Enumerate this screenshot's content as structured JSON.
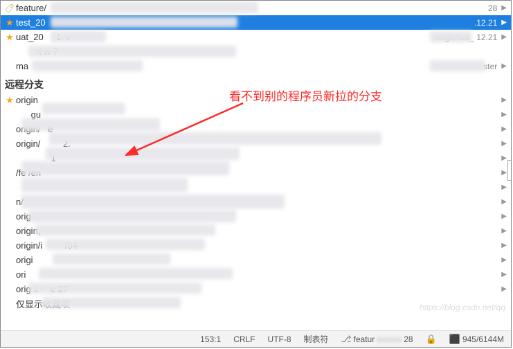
{
  "local_branches": [
    {
      "name": "feature/",
      "tail": "28",
      "right": "28",
      "icon": "tag",
      "star": false,
      "selected": false,
      "arrow": true
    },
    {
      "name": "test_20",
      "tail": "",
      "right": ".12.21",
      "icon": "",
      "star": true,
      "selected": true,
      "arrow": true
    },
    {
      "name": "uat_20",
      "tail": "1",
      "right": "origin/uat_      12.21",
      "icon": "",
      "star": true,
      "selected": false,
      "arrow": true,
      "bluedown": true
    },
    {
      "name": "",
      "tail": "rt  w               7",
      "right": "",
      "icon": "",
      "star": false,
      "selected": false,
      "arrow": false
    },
    {
      "name": "ma",
      "tail": "",
      "right": "ster",
      "icon": "",
      "star": false,
      "selected": false,
      "arrow": true
    }
  ],
  "remote_header": "远程分支",
  "remote_branches": [
    {
      "name": "origin",
      "star": true,
      "arrow": true
    },
    {
      "name": "",
      "tail": "gu",
      "arrow": true
    },
    {
      "name": "origin/",
      "tail": "e",
      "arrow": true
    },
    {
      "name": "origin/",
      "tail": "2.",
      "arrow": true
    },
    {
      "name": "",
      "tail": "1",
      "arrow": true
    },
    {
      "name": "/fe    /en",
      "arrow": true
    },
    {
      "name": "",
      "arrow": true
    },
    {
      "name": "  n/",
      "arrow": true
    },
    {
      "name": "orig",
      "arrow": true
    },
    {
      "name": "origin,",
      "arrow": true
    },
    {
      "name": "origin/i",
      "tail": "/04",
      "arrow": true
    },
    {
      "name": "origi",
      "arrow": true
    },
    {
      "name": "ori",
      "arrow": true
    },
    {
      "name": "orig     s",
      "tail": "e    27",
      "arrow": true
    }
  ],
  "favorites_toggle": "仅显示收藏项",
  "annotation": "看不到别的程序员新拉的分支",
  "watermark": "https://blog.csdn.net/qq",
  "statusbar": {
    "position": "153:1",
    "line_ending": "CRLF",
    "encoding": "UTF-8",
    "indent": "制表符",
    "branch_prefix": "featur",
    "branch_suffix": "28",
    "memory": "945/6144M"
  }
}
